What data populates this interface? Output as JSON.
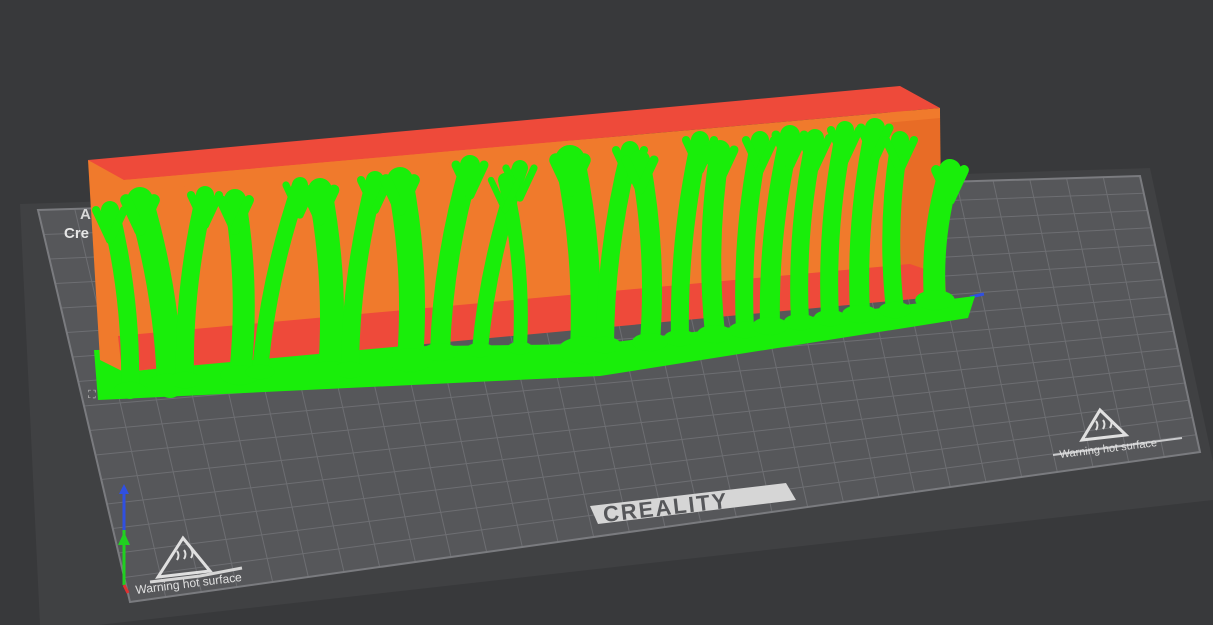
{
  "bed": {
    "brand": "CREALITY",
    "warning_left": "Warning hot surface",
    "warning_right": "Warning hot surface",
    "corner_text_1": "A",
    "corner_text_2": "Cre"
  },
  "colors": {
    "background": "#38393b",
    "bed_surface": "#56575a",
    "bed_frame": "#404143",
    "grid": "#6d6e72",
    "model_top": "#ee4a3a",
    "model_wall": "#f07a2c",
    "support": "#19ee0a",
    "axis_x": "#e03030",
    "axis_y": "#20d020",
    "axis_z": "#3050e0"
  },
  "icons": [
    "hot-surface-warning-icon",
    "axis-gizmo-icon"
  ]
}
